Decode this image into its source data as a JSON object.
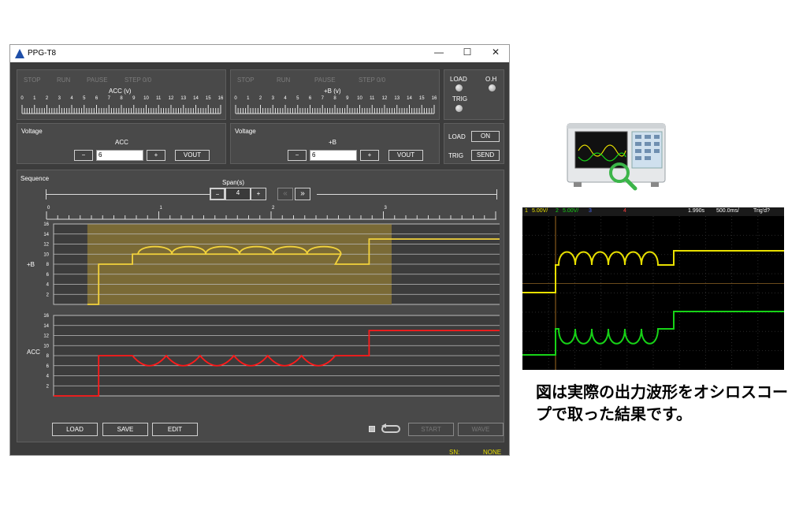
{
  "window": {
    "title": "PPG-T8",
    "minimize": "—",
    "maximize": "☐",
    "close": "✕"
  },
  "status_row": {
    "stop": "STOP",
    "run": "RUN",
    "pause": "PAUSE",
    "step": "STEP 0/0"
  },
  "acc_slider": {
    "label": "ACC (v)"
  },
  "b_slider": {
    "label": "+B (v)"
  },
  "slider_ticks": [
    "0",
    "1",
    "2",
    "3",
    "4",
    "5",
    "6",
    "7",
    "8",
    "9",
    "10",
    "11",
    "12",
    "13",
    "14",
    "15",
    "16"
  ],
  "indicators": {
    "load": "LOAD",
    "oh": "O.H",
    "trig": "TRIG"
  },
  "voltage_acc": {
    "title": "Voltage",
    "name": "ACC",
    "minus": "−",
    "value": "6",
    "plus": "+",
    "vout": "VOUT"
  },
  "voltage_b": {
    "title": "Voltage",
    "name": "+B",
    "minus": "−",
    "value": "6",
    "plus": "+",
    "vout": "VOUT"
  },
  "control": {
    "load": "LOAD",
    "on": "ON",
    "trig": "TRIG",
    "send": "SEND"
  },
  "sequence": {
    "title": "Sequence",
    "span_label": "Span(s)",
    "span_minus": "−",
    "span_value": "4",
    "span_plus": "+",
    "prev": "«",
    "next": "»",
    "time_ticks": [
      "0",
      "1",
      "2",
      "3"
    ]
  },
  "chart_data": [
    {
      "type": "line",
      "ylabel": "+B",
      "ylim": [
        0,
        16
      ],
      "yticks": [
        "2",
        "4",
        "6",
        "8",
        "10",
        "12",
        "14",
        "16"
      ],
      "xlim": [
        0,
        4
      ],
      "highlight_range": [
        0.3,
        3.0
      ],
      "series": [
        {
          "color": "#f2d23c",
          "points": [
            [
              0.3,
              0
            ],
            [
              0.4,
              0
            ],
            [
              0.4,
              8
            ],
            [
              0.7,
              8
            ],
            [
              0.7,
              10
            ],
            [
              0.75,
              10
            ],
            [
              1.05,
              10
            ],
            [
              1.35,
              10
            ],
            [
              1.65,
              10
            ],
            [
              1.95,
              10
            ],
            [
              2.25,
              10
            ],
            [
              2.5,
              10
            ],
            [
              2.5,
              8
            ],
            [
              2.8,
              8
            ],
            [
              2.8,
              13
            ],
            [
              4,
              13
            ]
          ],
          "bumps": {
            "from": 0.75,
            "to": 2.55,
            "count": 6,
            "base": 10,
            "peak": 12
          }
        }
      ]
    },
    {
      "type": "line",
      "ylabel": "ACC",
      "ylim": [
        0,
        16
      ],
      "yticks": [
        "2",
        "4",
        "6",
        "8",
        "10",
        "12",
        "14",
        "16"
      ],
      "xlim": [
        0,
        4
      ],
      "series": [
        {
          "color": "#ff1a1a",
          "points": [
            [
              0,
              0
            ],
            [
              0.4,
              0
            ],
            [
              0.4,
              8
            ],
            [
              0.7,
              8
            ],
            [
              2.5,
              8
            ],
            [
              2.5,
              8
            ],
            [
              2.8,
              8
            ],
            [
              2.8,
              13
            ],
            [
              4,
              13
            ]
          ],
          "dips": {
            "from": 0.7,
            "to": 2.5,
            "count": 6,
            "base": 8,
            "trough": 6
          }
        }
      ]
    }
  ],
  "bottom": {
    "load": "LOAD",
    "save": "SAVE",
    "edit": "EDIT",
    "start": "START",
    "wave": "WAVE"
  },
  "statusbar": {
    "sn": "SN:",
    "none": "NONE"
  },
  "scope": {
    "ch1": "1",
    "ch1v": "5.00V/",
    "ch2": "2",
    "ch2v": "5.00V/",
    "ch3": "3",
    "ch4": "4",
    "time": "1.990s",
    "div": "500.0ms/",
    "trig": "Trig'd?",
    "yellow": "#e8e000",
    "green": "#17d317"
  },
  "caption": "図は実際の出力波形をオシロスコープで取った結果です。"
}
